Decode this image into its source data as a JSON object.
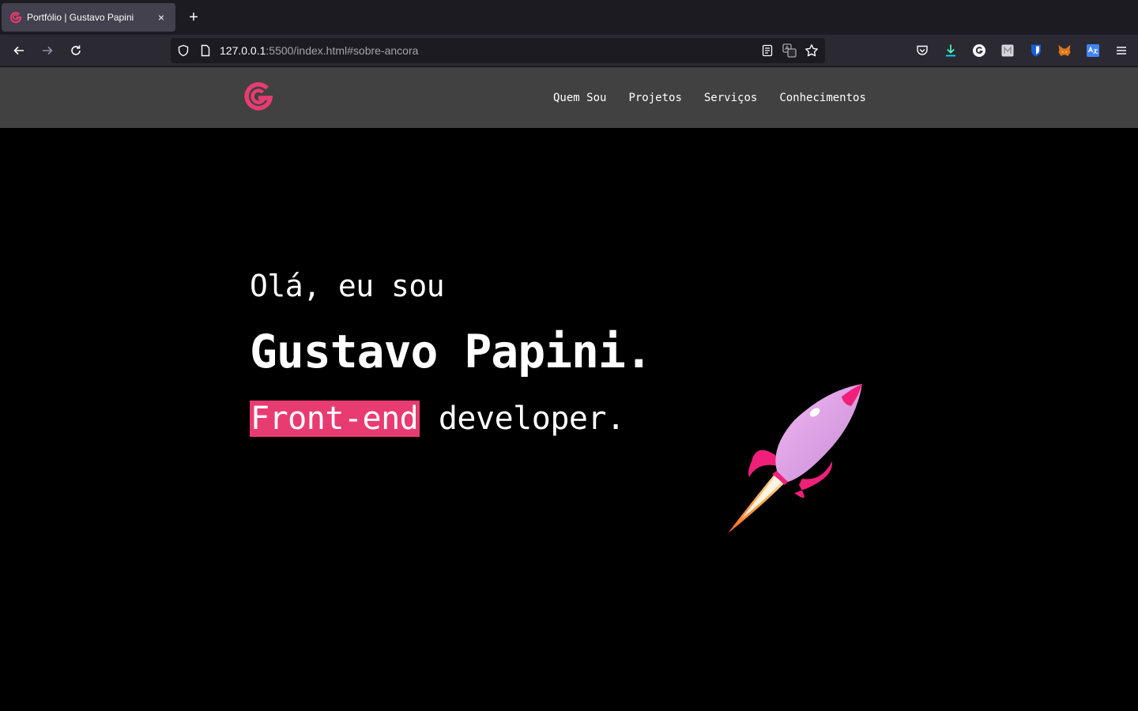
{
  "browser": {
    "tab_title": "Portfólio | Gustavo Papini",
    "tab_close": "×",
    "new_tab": "+",
    "url_host": "127.0.0.1",
    "url_rest": ":5500/index.html#sobre-ancora"
  },
  "site": {
    "brand_color": "#e83b72",
    "nav": [
      "Quem Sou",
      "Projetos",
      "Serviços",
      "Conhecimentos"
    ]
  },
  "hero": {
    "greeting": "Olá, eu sou",
    "name": "Gustavo Papini.",
    "role_highlight": "Front-end",
    "role_rest": " developer."
  }
}
